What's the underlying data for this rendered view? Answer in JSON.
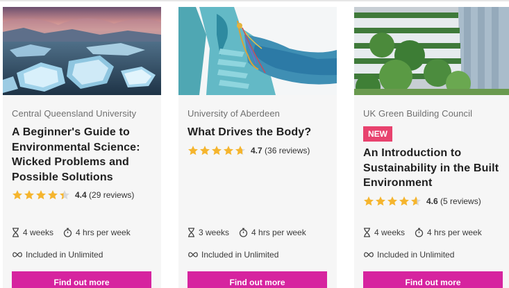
{
  "cards": [
    {
      "image": "glacier-ice-photo",
      "provider": "Central Queensland University",
      "title": "A Beginner's Guide to Environmental Science: Wicked Problems and Possible Solutions",
      "rating": "4.4",
      "rating_value": 4.4,
      "reviews": "(29 reviews)",
      "duration": "4 weeks",
      "effort": "4 hrs per week",
      "unlimited": "Included in Unlimited",
      "cta": "Find out more"
    },
    {
      "image": "anatomy-body-illustration",
      "provider": "University of Aberdeen",
      "title": "What Drives the Body?",
      "rating": "4.7",
      "rating_value": 4.7,
      "reviews": "(36 reviews)",
      "duration": "3 weeks",
      "effort": "4 hrs per week",
      "unlimited": "Included in Unlimited",
      "cta": "Find out more"
    },
    {
      "image": "green-building-photo",
      "provider": "UK Green Building Council",
      "badge": "NEW",
      "title": "An Introduction to Sustainability in the Built Environment",
      "rating": "4.6",
      "rating_value": 4.6,
      "reviews": "(5 reviews)",
      "duration": "4 weeks",
      "effort": "4 hrs per week",
      "unlimited": "Included in Unlimited",
      "cta": "Find out more"
    }
  ],
  "colors": {
    "cta_bg": "#d6249f",
    "badge_bg": "#e8426e",
    "star": "#f5b52e",
    "card_bg": "#f6f6f6"
  }
}
